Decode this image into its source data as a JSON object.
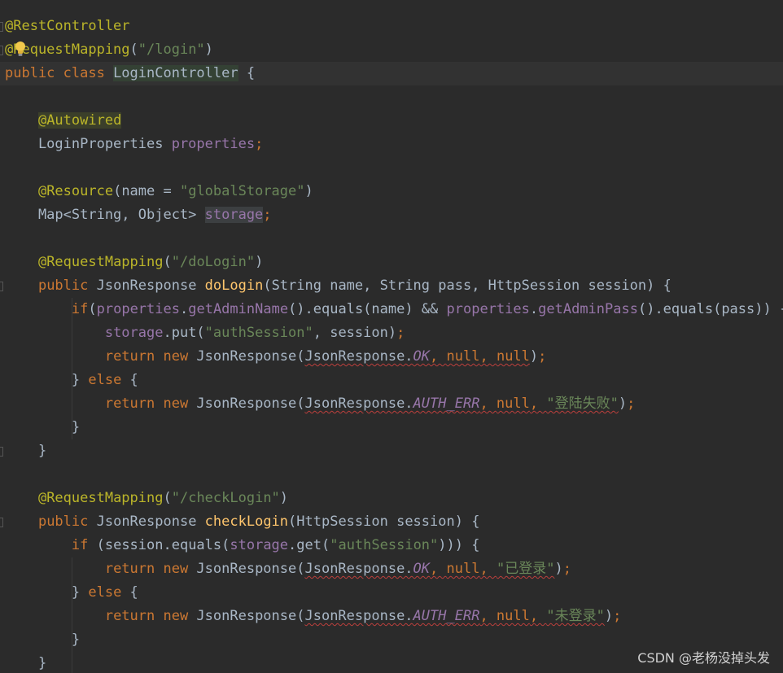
{
  "editor": {
    "lines": [
      {
        "tokens": [
          {
            "t": "@RestController",
            "c": "ann"
          }
        ]
      },
      {
        "tokens": [
          {
            "t": "@RequestMapping",
            "c": "ann"
          },
          {
            "t": "(",
            "c": "plain"
          },
          {
            "t": "\"/login\"",
            "c": "str"
          },
          {
            "t": ")",
            "c": "plain"
          }
        ]
      },
      {
        "tokens": [
          {
            "t": "public class ",
            "c": "kw"
          },
          {
            "t": "LoginController",
            "c": "plain hl-cls"
          },
          {
            "t": " {",
            "c": "plain"
          }
        ]
      },
      {
        "tokens": []
      },
      {
        "tokens": [
          {
            "t": "    ",
            "c": "plain"
          },
          {
            "t": "@Autowired",
            "c": "ann hl-ann"
          }
        ]
      },
      {
        "tokens": [
          {
            "t": "    LoginProperties ",
            "c": "plain"
          },
          {
            "t": "properties",
            "c": "fld"
          },
          {
            "t": ";",
            "c": "kw"
          }
        ]
      },
      {
        "tokens": []
      },
      {
        "tokens": [
          {
            "t": "    ",
            "c": "plain"
          },
          {
            "t": "@Resource",
            "c": "ann"
          },
          {
            "t": "(name = ",
            "c": "plain"
          },
          {
            "t": "\"globalStorage\"",
            "c": "str"
          },
          {
            "t": ")",
            "c": "plain"
          }
        ]
      },
      {
        "tokens": [
          {
            "t": "    Map<String, Object> ",
            "c": "plain"
          },
          {
            "t": "storage",
            "c": "fld hl-fld"
          },
          {
            "t": ";",
            "c": "kw"
          }
        ]
      },
      {
        "tokens": []
      },
      {
        "tokens": [
          {
            "t": "    ",
            "c": "plain"
          },
          {
            "t": "@RequestMapping",
            "c": "ann"
          },
          {
            "t": "(",
            "c": "plain"
          },
          {
            "t": "\"/doLogin\"",
            "c": "str"
          },
          {
            "t": ")",
            "c": "plain"
          }
        ]
      },
      {
        "tokens": [
          {
            "t": "    ",
            "c": "plain"
          },
          {
            "t": "public ",
            "c": "kw"
          },
          {
            "t": "JsonResponse ",
            "c": "plain"
          },
          {
            "t": "doLogin",
            "c": "mth"
          },
          {
            "t": "(String name, String pass, HttpSession session) {",
            "c": "plain"
          }
        ]
      },
      {
        "tokens": [
          {
            "t": "        ",
            "c": "plain"
          },
          {
            "t": "if",
            "c": "kw"
          },
          {
            "t": "(",
            "c": "plain"
          },
          {
            "t": "properties",
            "c": "fld"
          },
          {
            "t": ".",
            "c": "plain"
          },
          {
            "t": "getAdminName",
            "c": "fld"
          },
          {
            "t": "().equals(name) && ",
            "c": "plain"
          },
          {
            "t": "properties",
            "c": "fld"
          },
          {
            "t": ".",
            "c": "plain"
          },
          {
            "t": "getAdminPass",
            "c": "fld"
          },
          {
            "t": "().equals(pass)) {",
            "c": "plain"
          }
        ]
      },
      {
        "tokens": [
          {
            "t": "            ",
            "c": "plain"
          },
          {
            "t": "storage",
            "c": "fld"
          },
          {
            "t": ".put(",
            "c": "plain"
          },
          {
            "t": "\"authSession\"",
            "c": "str"
          },
          {
            "t": ", session)",
            "c": "plain"
          },
          {
            "t": ";",
            "c": "kw"
          }
        ]
      },
      {
        "tokens": [
          {
            "t": "            ",
            "c": "plain"
          },
          {
            "t": "return new ",
            "c": "kw"
          },
          {
            "t": "JsonResponse(",
            "c": "plain"
          },
          {
            "t": "JsonResponse.",
            "c": "plain squig"
          },
          {
            "t": "OK",
            "c": "sta squig"
          },
          {
            "t": ", ",
            "c": "kw squig"
          },
          {
            "t": "null",
            "c": "kw squig"
          },
          {
            "t": ", ",
            "c": "kw squig"
          },
          {
            "t": "null",
            "c": "kw squig"
          },
          {
            "t": ")",
            "c": "plain"
          },
          {
            "t": ";",
            "c": "kw"
          }
        ]
      },
      {
        "tokens": [
          {
            "t": "        } ",
            "c": "plain"
          },
          {
            "t": "else ",
            "c": "kw"
          },
          {
            "t": "{",
            "c": "plain"
          }
        ]
      },
      {
        "tokens": [
          {
            "t": "            ",
            "c": "plain"
          },
          {
            "t": "return new ",
            "c": "kw"
          },
          {
            "t": "JsonResponse(",
            "c": "plain"
          },
          {
            "t": "JsonResponse.",
            "c": "plain squig"
          },
          {
            "t": "AUTH_ERR",
            "c": "sta squig"
          },
          {
            "t": ", ",
            "c": "kw squig"
          },
          {
            "t": "null",
            "c": "kw squig"
          },
          {
            "t": ", ",
            "c": "kw squig"
          },
          {
            "t": "\"登陆失败\"",
            "c": "str squig"
          },
          {
            "t": ")",
            "c": "plain"
          },
          {
            "t": ";",
            "c": "kw"
          }
        ]
      },
      {
        "tokens": [
          {
            "t": "        }",
            "c": "plain"
          }
        ]
      },
      {
        "tokens": [
          {
            "t": "    }",
            "c": "plain"
          }
        ]
      },
      {
        "tokens": []
      },
      {
        "tokens": [
          {
            "t": "    ",
            "c": "plain"
          },
          {
            "t": "@RequestMapping",
            "c": "ann"
          },
          {
            "t": "(",
            "c": "plain"
          },
          {
            "t": "\"/checkLogin\"",
            "c": "str"
          },
          {
            "t": ")",
            "c": "plain"
          }
        ]
      },
      {
        "tokens": [
          {
            "t": "    ",
            "c": "plain"
          },
          {
            "t": "public ",
            "c": "kw"
          },
          {
            "t": "JsonResponse ",
            "c": "plain"
          },
          {
            "t": "checkLogin",
            "c": "mth"
          },
          {
            "t": "(HttpSession session) {",
            "c": "plain"
          }
        ]
      },
      {
        "tokens": [
          {
            "t": "        ",
            "c": "plain"
          },
          {
            "t": "if ",
            "c": "kw"
          },
          {
            "t": "(session.equals(",
            "c": "plain"
          },
          {
            "t": "storage",
            "c": "fld"
          },
          {
            "t": ".get(",
            "c": "plain"
          },
          {
            "t": "\"authSession\"",
            "c": "str"
          },
          {
            "t": "))) {",
            "c": "plain"
          }
        ]
      },
      {
        "tokens": [
          {
            "t": "            ",
            "c": "plain"
          },
          {
            "t": "return new ",
            "c": "kw"
          },
          {
            "t": "JsonResponse(",
            "c": "plain"
          },
          {
            "t": "JsonResponse.",
            "c": "plain squig"
          },
          {
            "t": "OK",
            "c": "sta squig"
          },
          {
            "t": ", ",
            "c": "kw squig"
          },
          {
            "t": "null",
            "c": "kw squig"
          },
          {
            "t": ", ",
            "c": "kw squig"
          },
          {
            "t": "\"已登录\"",
            "c": "str squig"
          },
          {
            "t": ")",
            "c": "plain"
          },
          {
            "t": ";",
            "c": "kw"
          }
        ]
      },
      {
        "tokens": [
          {
            "t": "        } ",
            "c": "plain"
          },
          {
            "t": "else ",
            "c": "kw"
          },
          {
            "t": "{",
            "c": "plain"
          }
        ]
      },
      {
        "tokens": [
          {
            "t": "            ",
            "c": "plain"
          },
          {
            "t": "return new ",
            "c": "kw"
          },
          {
            "t": "JsonResponse(",
            "c": "plain"
          },
          {
            "t": "JsonResponse.",
            "c": "plain squig"
          },
          {
            "t": "AUTH_ERR",
            "c": "sta squig"
          },
          {
            "t": ", ",
            "c": "kw squig"
          },
          {
            "t": "null",
            "c": "kw squig"
          },
          {
            "t": ", ",
            "c": "kw squig"
          },
          {
            "t": "\"未登录\"",
            "c": "str squig"
          },
          {
            "t": ")",
            "c": "plain"
          },
          {
            "t": ";",
            "c": "kw"
          }
        ]
      },
      {
        "tokens": [
          {
            "t": "        }",
            "c": "plain"
          }
        ]
      },
      {
        "tokens": [
          {
            "t": "    }",
            "c": "plain"
          }
        ]
      }
    ],
    "current_line": 2,
    "gutter_marks": [
      0,
      1,
      11,
      18,
      21,
      28
    ]
  },
  "icons": {
    "intention": "lightbulb-icon"
  },
  "watermark": {
    "text": "CSDN @老杨没掉头发"
  },
  "colors": {
    "background": "#2b2b2b",
    "keyword": "#cc7832",
    "annotation": "#bbb529",
    "string": "#6a8759",
    "field": "#9876aa",
    "method": "#ffc66d",
    "plain": "#a9b7c6"
  }
}
